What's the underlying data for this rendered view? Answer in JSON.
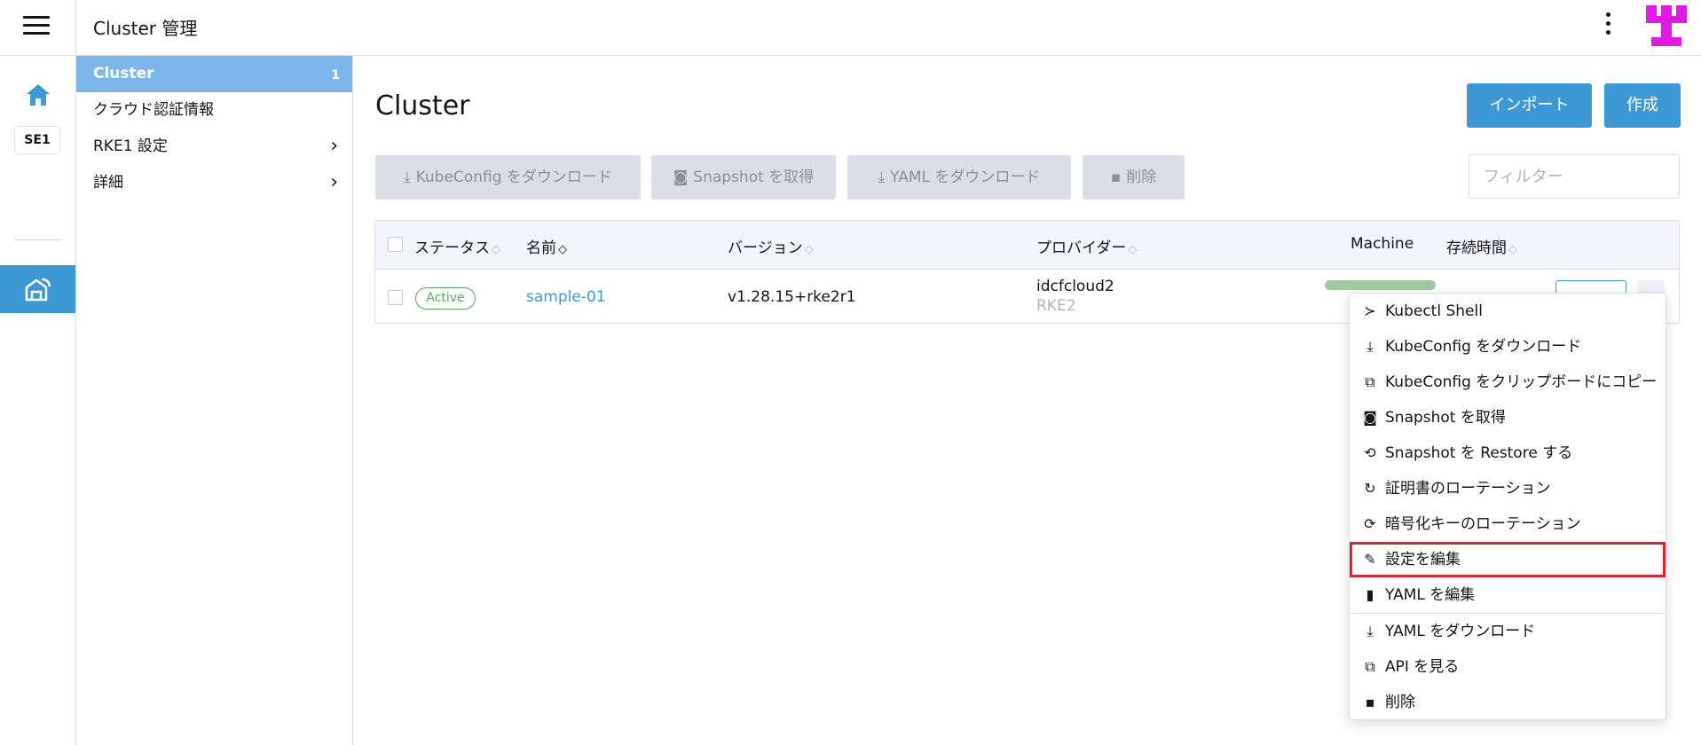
{
  "header": {
    "title": "Cluster 管理"
  },
  "rail": {
    "cluster_badge": "SE1"
  },
  "sidenav": {
    "items": [
      {
        "label": "Cluster",
        "count": "1",
        "active": true
      },
      {
        "label": "クラウド認証情報"
      },
      {
        "label": "RKE1 設定",
        "chevron": "›"
      },
      {
        "label": "詳細",
        "chevron": "›"
      }
    ]
  },
  "main": {
    "title": "Cluster",
    "import_label": "インポート",
    "create_label": "作成",
    "bulk_actions": [
      {
        "label": "KubeConfig をダウンロード",
        "icon": "download-icon"
      },
      {
        "label": "Snapshot を取得",
        "icon": "camera-icon"
      },
      {
        "label": "YAML をダウンロード",
        "icon": "download-icon"
      },
      {
        "label": "削除",
        "icon": "trash-icon"
      }
    ],
    "filter_placeholder": "フィルター"
  },
  "table": {
    "columns": [
      "ステータス",
      "名前",
      "バージョン",
      "プロバイダー",
      "Machine",
      "存続時間"
    ],
    "rows": [
      {
        "status": "Active",
        "name": "sample-01",
        "version": "v1.28.15+rke2r1",
        "provider": "idcfcloud2",
        "provider_sub": "RKE2"
      }
    ]
  },
  "context_menu": {
    "items": [
      {
        "label": "Kubectl Shell",
        "icon": "terminal-icon",
        "glyph": "≻"
      },
      {
        "label": "KubeConfig をダウンロード",
        "icon": "download-icon",
        "glyph": "⤓"
      },
      {
        "label": "KubeConfig をクリップボードにコピー",
        "icon": "copy-icon",
        "glyph": "⧉"
      },
      {
        "label": "Snapshot を取得",
        "icon": "camera-icon",
        "glyph": "◙"
      },
      {
        "label": "Snapshot を Restore する",
        "icon": "restore-icon",
        "glyph": "⟲"
      },
      {
        "label": "証明書のローテーション",
        "icon": "rotate-icon",
        "glyph": "↻"
      },
      {
        "label": "暗号化キーのローテーション",
        "icon": "refresh-icon",
        "glyph": "⟳"
      },
      {
        "label": "設定を編集",
        "icon": "pencil-icon",
        "glyph": "✎",
        "highlighted": true
      },
      {
        "label": "YAML を編集",
        "icon": "file-icon",
        "glyph": "▮"
      },
      {
        "label": "YAML をダウンロード",
        "icon": "download-icon",
        "glyph": "⤓"
      },
      {
        "label": "API を見る",
        "icon": "external-link-icon",
        "glyph": "⧉"
      },
      {
        "label": "削除",
        "icon": "trash-icon",
        "glyph": "▪"
      }
    ]
  },
  "colors": {
    "accent": "#3d98d3",
    "active_nav": "#7cb6ea",
    "status_active": "#5aa56b",
    "highlight_outline": "#d8262e",
    "logo": "#e01ae0"
  }
}
